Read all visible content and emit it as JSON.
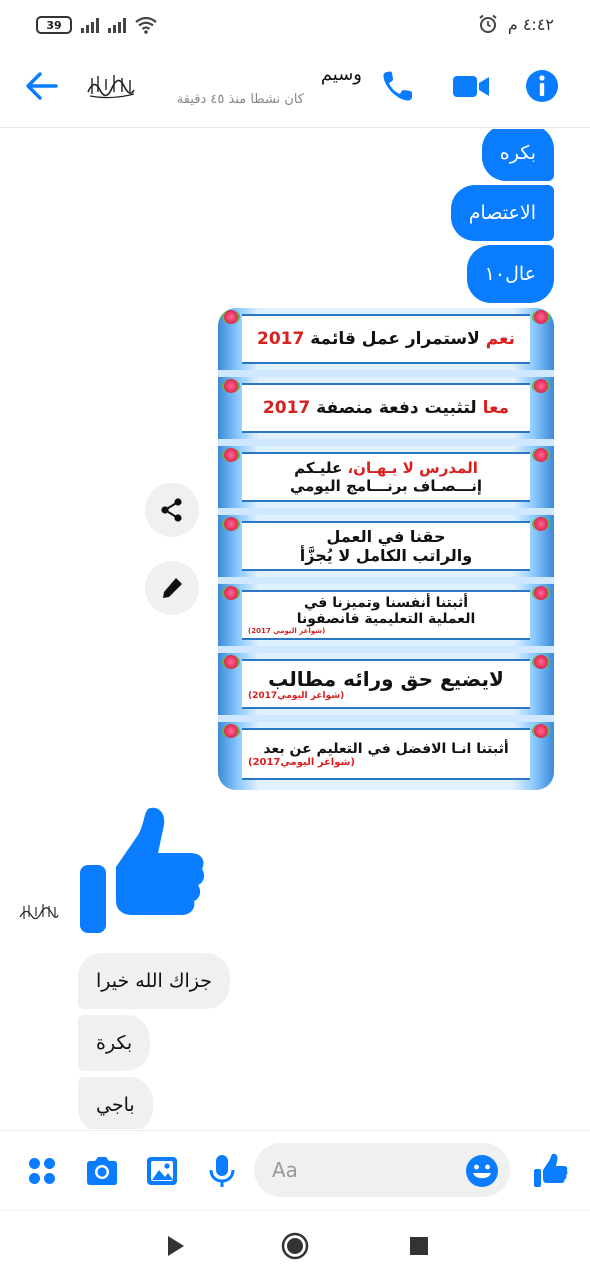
{
  "status_bar": {
    "time": "٤:٤٢ م",
    "battery": "39"
  },
  "header": {
    "contact_name": "وسيم",
    "status": "كان نشطا منذ ٤٥ دقيقة",
    "avatar_text": "لا إله إلا الله"
  },
  "messages": {
    "out": [
      "بكره",
      "الاعتصام",
      "عال١٠"
    ],
    "in": [
      "جزاك الله خيرا",
      "بكرة",
      "باجي"
    ]
  },
  "poster": {
    "strips": [
      {
        "red": "نعم",
        "text": " لاستمرار عمل قائمة ",
        "year": "2017"
      },
      {
        "red": "معا",
        "text": " لتثبيت دفعة منصفة ",
        "year": "2017"
      },
      {
        "red": "المدرس لا يـهـان،",
        "text": " عليـكم",
        "line2": "إنـــصـاف برنـــامج اليومي"
      },
      {
        "text": "حقنا في العمل",
        "line2": "والراتب الكامل لا يُجزَّأ"
      },
      {
        "text": "أثبتنا أنفسنا وتميزنا في",
        "line2": "العملية التعليمية فانصفونا",
        "tag": "(شواغر اليومي 2017)"
      },
      {
        "text": "لايضيع حق ورائه مطالب",
        "tag": "(شواغر اليومي2017)"
      },
      {
        "text": "أثبتنا انـا الافضل في التعليم عن بعد",
        "tag": "(شواغر اليومي2017)"
      }
    ]
  },
  "composer": {
    "placeholder": "Aa"
  },
  "colors": {
    "accent": "#0a7cff",
    "in_bubble": "#f0f0f0"
  },
  "icons": {
    "header": [
      "back-arrow-icon",
      "phone-icon",
      "video-icon",
      "info-icon"
    ],
    "composer": [
      "apps-icon",
      "camera-icon",
      "gallery-icon",
      "mic-icon",
      "emoji-icon",
      "like-icon"
    ],
    "side": [
      "share-icon",
      "edit-icon"
    ],
    "nav": [
      "back-triangle-icon",
      "home-circle-icon",
      "recents-square-icon"
    ]
  }
}
